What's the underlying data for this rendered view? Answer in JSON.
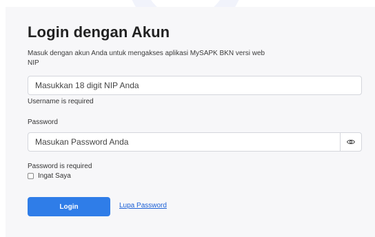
{
  "login": {
    "title": "Login dengan Akun",
    "subtitle": "Masuk dengan akun Anda untuk mengakses aplikasi MySAPK BKN versi web",
    "nip_label": "NIP",
    "nip_placeholder": "Masukkan 18 digit NIP Anda",
    "nip_error": "Username is required",
    "password_label": "Password",
    "password_placeholder": "Masukan Password Anda",
    "password_error": "Password is required",
    "remember_label": "Ingat Saya",
    "login_button": "Login",
    "forgot_link": "Lupa Password"
  },
  "icons": {
    "show_password": "eye-icon"
  },
  "colors": {
    "primary": "#2f7de8",
    "link": "#1a5fd6",
    "card_bg": "#f7f7f9"
  }
}
